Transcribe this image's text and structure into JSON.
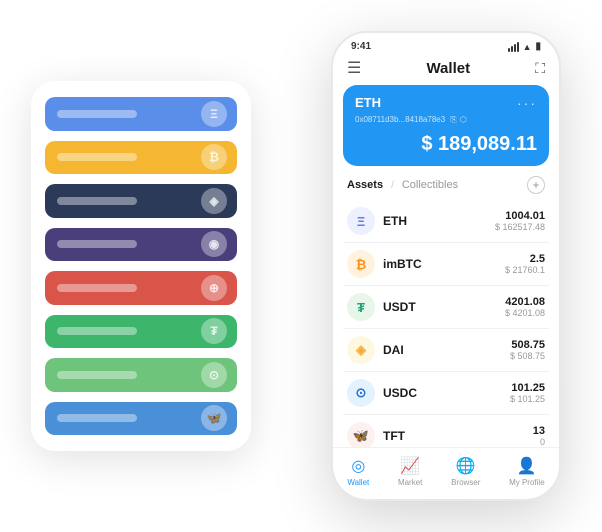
{
  "app": {
    "title": "Wallet"
  },
  "status_bar": {
    "time": "9:41",
    "battery": "🔋"
  },
  "header": {
    "menu_icon": "☰",
    "title": "Wallet",
    "expand_icon": "⛶"
  },
  "eth_card": {
    "name": "ETH",
    "dots": "···",
    "address": "0x08711d3b...8418a78e3",
    "address_icon1": "⧉",
    "address_icon2": "⬡",
    "amount": "$ 189,089.11",
    "amount_symbol": "$"
  },
  "assets": {
    "tab_active": "Assets",
    "divider": "/",
    "tab_inactive": "Collectibles",
    "add_icon": "+"
  },
  "asset_list": [
    {
      "icon": "Ξ",
      "icon_class": "icon-eth",
      "name": "ETH",
      "qty": "1004.01",
      "usd": "$ 162517.48"
    },
    {
      "icon": "₿",
      "icon_class": "icon-imbtc",
      "name": "imBTC",
      "qty": "2.5",
      "usd": "$ 21760.1"
    },
    {
      "icon": "₮",
      "icon_class": "icon-usdt",
      "name": "USDT",
      "qty": "4201.08",
      "usd": "$ 4201.08"
    },
    {
      "icon": "◈",
      "icon_class": "icon-dai",
      "name": "DAI",
      "qty": "508.75",
      "usd": "$ 508.75"
    },
    {
      "icon": "⊙",
      "icon_class": "icon-usdc",
      "name": "USDC",
      "qty": "101.25",
      "usd": "$ 101.25"
    },
    {
      "icon": "🦋",
      "icon_class": "icon-tft",
      "name": "TFT",
      "qty": "13",
      "usd": "0"
    }
  ],
  "bottom_nav": [
    {
      "icon": "◎",
      "label": "Wallet",
      "active": true
    },
    {
      "icon": "📈",
      "label": "Market",
      "active": false
    },
    {
      "icon": "🌐",
      "label": "Browser",
      "active": false
    },
    {
      "icon": "👤",
      "label": "My Profile",
      "active": false
    }
  ],
  "bg_strips": [
    {
      "color": "#5B8EE8",
      "icon": "Ξ"
    },
    {
      "color": "#F5B731",
      "icon": "₿"
    },
    {
      "color": "#2C3A5A",
      "icon": "◈"
    },
    {
      "color": "#4A3F7A",
      "icon": "◉"
    },
    {
      "color": "#D9554A",
      "icon": "⊕"
    },
    {
      "color": "#3DB56B",
      "icon": "₮"
    },
    {
      "color": "#6DC47A",
      "icon": "⊙"
    },
    {
      "color": "#4A90D9",
      "icon": "🦋"
    }
  ]
}
